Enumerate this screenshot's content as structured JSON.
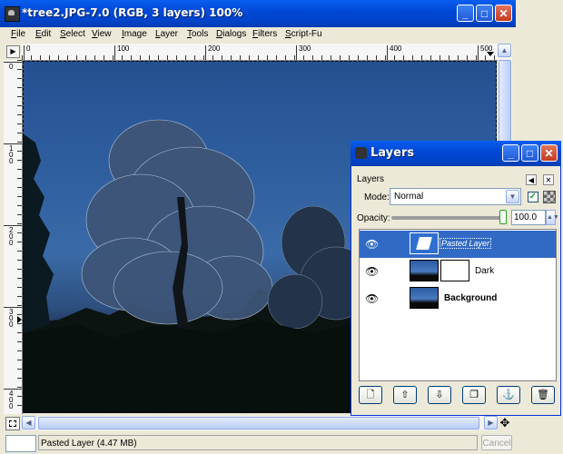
{
  "main_window": {
    "title": "*tree2.JPG-7.0 (RGB, 3 layers) 100%",
    "controls": {
      "minimize": "_",
      "maximize": "□",
      "close": "✕"
    }
  },
  "menubar": [
    {
      "label": "File",
      "u": "F",
      "rest": "ile"
    },
    {
      "label": "Edit",
      "u": "E",
      "rest": "dit"
    },
    {
      "label": "Select",
      "u": "S",
      "rest": "elect"
    },
    {
      "label": "View",
      "u": "V",
      "rest": "iew"
    },
    {
      "label": "Image",
      "u": "I",
      "rest": "mage"
    },
    {
      "label": "Layer",
      "u": "L",
      "rest": "ayer"
    },
    {
      "label": "Tools",
      "u": "T",
      "rest": "ools"
    },
    {
      "label": "Dialogs",
      "u": "D",
      "rest": "ialogs"
    },
    {
      "label": "Filters",
      "u": "F",
      "rest": "ilters"
    },
    {
      "label": "Script-Fu",
      "u": "S",
      "rest": "cript-Fu"
    }
  ],
  "rulers": {
    "horizontal_labels": [
      "0",
      "100",
      "200",
      "300",
      "400",
      "500"
    ],
    "vertical_labels": [
      "0",
      "100",
      "200",
      "300",
      "400"
    ]
  },
  "statusbar": {
    "text": "Pasted Layer (4.47 MB)",
    "cancel_label": "Cancel"
  },
  "layers_dialog": {
    "title": "Layers",
    "panel_title": "Layers",
    "mode_label": "Mode:",
    "mode_value": "Normal",
    "keep_transparency_checked": true,
    "opacity_label": "Opacity:",
    "opacity_value": "100.0",
    "layers": [
      {
        "name": "Pasted Layer",
        "visible": true,
        "selected": true
      },
      {
        "name": "Dark",
        "visible": true,
        "selected": false,
        "has_mask": true
      },
      {
        "name": "Background",
        "visible": true,
        "selected": false
      }
    ]
  },
  "colors": {
    "title_blue": "#0049d6",
    "selection_blue": "#316ac5",
    "window_bg": "#ece9d8",
    "sky": "#2f5e9f"
  }
}
